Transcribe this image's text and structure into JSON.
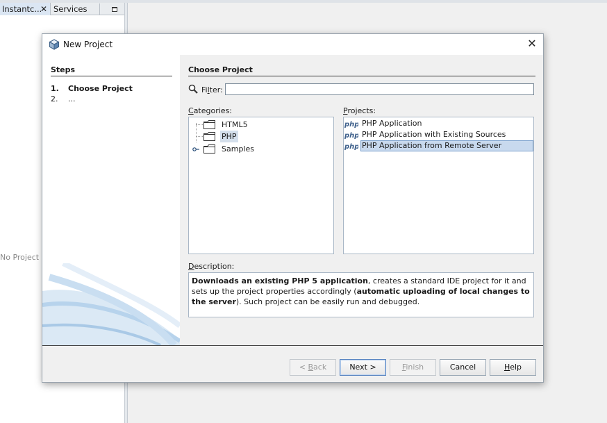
{
  "ide": {
    "tabs": [
      {
        "label": "Instantc...",
        "close": "✕"
      },
      {
        "label": "Services"
      }
    ],
    "left_panel_text": "No Project Op"
  },
  "dialog": {
    "title": "New Project",
    "close_glyph": "✕",
    "steps": {
      "title": "Steps",
      "items": [
        {
          "num": "1.",
          "label": "Choose Project"
        },
        {
          "num": "2.",
          "label": "..."
        }
      ]
    },
    "content": {
      "section_title": "Choose Project",
      "filter": {
        "label_pre": "Fi",
        "label_mnemonic": "l",
        "label_post": "ter:",
        "value": ""
      },
      "categories": {
        "label_mnemonic": "C",
        "label_rest": "ategories:",
        "items": [
          {
            "label": "HTML5"
          },
          {
            "label": "PHP"
          },
          {
            "label": "Samples"
          }
        ]
      },
      "projects": {
        "label_mnemonic": "P",
        "label_rest": "rojects:",
        "items": [
          {
            "label": "PHP Application"
          },
          {
            "label": "PHP Application with Existing Sources"
          },
          {
            "label": "PHP Application from Remote Server"
          }
        ]
      },
      "description": {
        "label_mnemonic": "D",
        "label_rest": "escription:",
        "bold1": "Downloads an existing PHP 5 application",
        "text1": ", creates a standard IDE project for it and sets up the project properties accordingly (",
        "bold2": "automatic uploading of local changes to the server",
        "text2": "). Such project can be easily run and debugged."
      }
    },
    "buttons": {
      "back": {
        "pre": "< ",
        "mnemonic": "B",
        "post": "ack"
      },
      "next": {
        "label": "Next >"
      },
      "finish": {
        "pre": "",
        "mnemonic": "F",
        "post": "inish"
      },
      "cancel": {
        "label": "Cancel"
      },
      "help": {
        "pre": "",
        "mnemonic": "H",
        "post": "elp"
      }
    }
  }
}
